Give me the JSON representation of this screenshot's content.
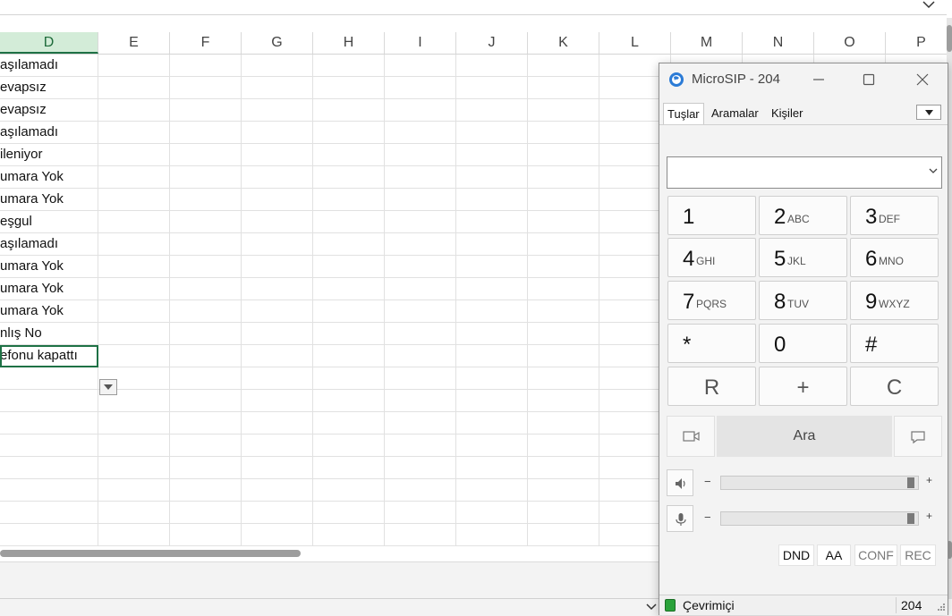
{
  "spreadsheet": {
    "columns": [
      "D",
      "E",
      "F",
      "G",
      "H",
      "I",
      "J",
      "K",
      "L",
      "M",
      "N",
      "O",
      "P"
    ],
    "active_column": "D",
    "column_d_values": [
      "aşılamadı",
      "evapsız",
      "evapsız",
      "aşılamadı",
      "ileniyor",
      "umara Yok",
      "umara Yok",
      "eşgul",
      "aşılamadı",
      "umara Yok",
      "umara Yok",
      "umara Yok",
      "nlış No",
      "efonu kapattı"
    ],
    "selected_row_index": 13
  },
  "microsip": {
    "title": "MicroSIP - 204",
    "tabs": [
      {
        "label": "Tuşlar",
        "active": true
      },
      {
        "label": "Aramalar",
        "active": false
      },
      {
        "label": "Kişiler",
        "active": false
      }
    ],
    "number_input": {
      "value": "",
      "placeholder": ""
    },
    "keypad": [
      {
        "digit": "1",
        "letters": ""
      },
      {
        "digit": "2",
        "letters": "ABC"
      },
      {
        "digit": "3",
        "letters": "DEF"
      },
      {
        "digit": "4",
        "letters": "GHI"
      },
      {
        "digit": "5",
        "letters": "JKL"
      },
      {
        "digit": "6",
        "letters": "MNO"
      },
      {
        "digit": "7",
        "letters": "PQRS"
      },
      {
        "digit": "8",
        "letters": "TUV"
      },
      {
        "digit": "9",
        "letters": "WXYZ"
      },
      {
        "digit": "*",
        "letters": ""
      },
      {
        "digit": "0",
        "letters": ""
      },
      {
        "digit": "#",
        "letters": ""
      },
      {
        "digit": "R",
        "letters": ""
      },
      {
        "digit": "+",
        "letters": ""
      },
      {
        "digit": "C",
        "letters": ""
      }
    ],
    "call_label": "Ara",
    "speaker": {
      "minus": "−",
      "plus": "+",
      "level": 0.98
    },
    "microphone": {
      "minus": "−",
      "plus": "+",
      "level": 0.98
    },
    "options": [
      "DND",
      "AA",
      "CONF",
      "REC"
    ],
    "status": {
      "text": "Çevrimiçi",
      "extension": "204",
      "color": "#2aa23a"
    }
  }
}
